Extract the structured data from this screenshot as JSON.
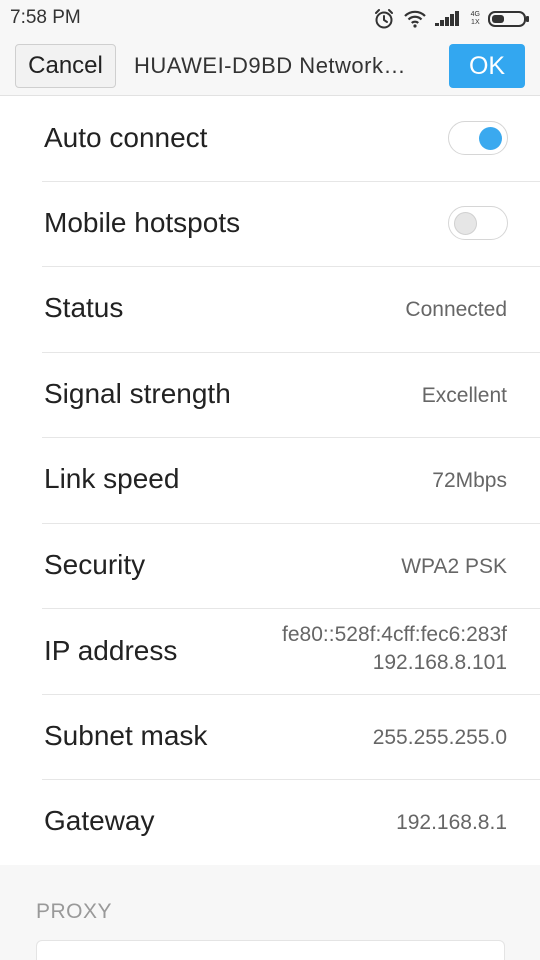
{
  "statusbar": {
    "time": "7:58 PM",
    "icons": [
      "alarm-icon",
      "wifi-icon",
      "signal-icon",
      "battery-icon"
    ],
    "net_top": "4G",
    "net_bottom": "1X"
  },
  "titlebar": {
    "cancel_label": "Cancel",
    "title": "HUAWEI-D9BD  Network…",
    "ok_label": "OK"
  },
  "colors": {
    "accent": "#33a7f0",
    "toggle_on": "#3aa9ef"
  },
  "settings": {
    "auto_connect": {
      "label": "Auto connect",
      "enabled": true
    },
    "mobile_hotspots": {
      "label": "Mobile hotspots",
      "enabled": false
    },
    "status": {
      "label": "Status",
      "value": "Connected"
    },
    "signal_strength": {
      "label": "Signal strength",
      "value": "Excellent"
    },
    "link_speed": {
      "label": "Link speed",
      "value": "72Mbps"
    },
    "security": {
      "label": "Security",
      "value": "WPA2 PSK"
    },
    "ip_address": {
      "label": "IP address",
      "value_ipv6": "fe80::528f:4cff:fec6:283f",
      "value_ipv4": "192.168.8.101"
    },
    "subnet_mask": {
      "label": "Subnet mask",
      "value": "255.255.255.0"
    },
    "gateway": {
      "label": "Gateway",
      "value": "192.168.8.1"
    }
  },
  "proxy": {
    "section_label": "PROXY"
  }
}
